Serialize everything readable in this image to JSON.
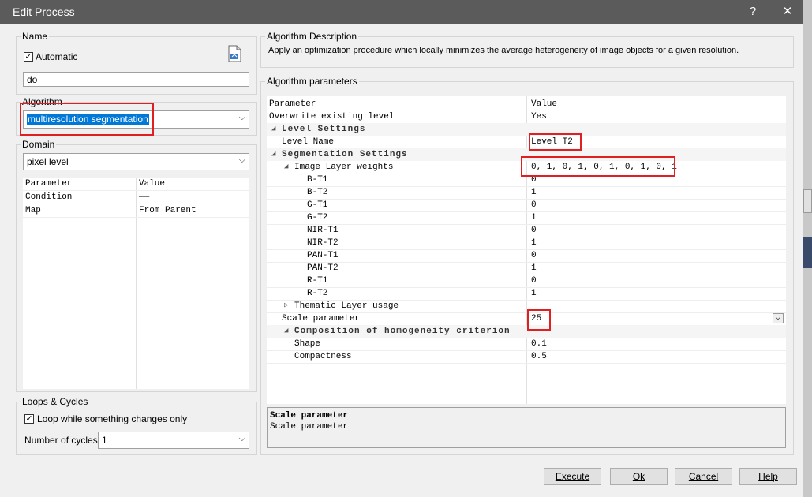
{
  "window": {
    "title": "Edit Process",
    "help_btn": "?",
    "close_btn": "✕"
  },
  "name_group": {
    "label": "Name",
    "automatic_label": "Automatic",
    "automatic_checked": "✓",
    "value": "do"
  },
  "algorithm_group": {
    "label": "Algorithm",
    "selected": "multiresolution segmentation"
  },
  "domain_group": {
    "label": "Domain",
    "selected": "pixel level",
    "table": {
      "headers": [
        "Parameter",
        "Value"
      ],
      "rows": [
        {
          "param": "Condition",
          "value": "——"
        },
        {
          "param": "Map",
          "value": "From Parent"
        }
      ]
    }
  },
  "loops_group": {
    "label": "Loops & Cycles",
    "loop_label": "Loop while something changes only",
    "loop_checked": "✓",
    "cycles_label": "Number of cycles",
    "cycles_value": "1"
  },
  "description_group": {
    "label": "Algorithm Description",
    "text": "Apply an optimization procedure which locally minimizes the average heterogeneity of image objects for a given resolution."
  },
  "params_group": {
    "label": "Algorithm parameters",
    "headers": [
      "Parameter",
      "Value"
    ],
    "rows": [
      {
        "param": "Overwrite existing level",
        "value": "Yes"
      },
      {
        "param": "Level Settings",
        "value": ""
      },
      {
        "param": "Level Name",
        "value": "Level T2"
      },
      {
        "param": "Segmentation Settings",
        "value": ""
      },
      {
        "param": "Image Layer weights",
        "value": "0, 1, 0, 1, 0, 1, 0, 1, 0, 1"
      },
      {
        "param": "B-T1",
        "value": "0"
      },
      {
        "param": "B-T2",
        "value": "1"
      },
      {
        "param": "G-T1",
        "value": "0"
      },
      {
        "param": "G-T2",
        "value": "1"
      },
      {
        "param": "NIR-T1",
        "value": "0"
      },
      {
        "param": "NIR-T2",
        "value": "1"
      },
      {
        "param": "PAN-T1",
        "value": "0"
      },
      {
        "param": "PAN-T2",
        "value": "1"
      },
      {
        "param": "R-T1",
        "value": "0"
      },
      {
        "param": "R-T2",
        "value": "1"
      },
      {
        "param": "Thematic Layer usage",
        "value": ""
      },
      {
        "param": "Scale parameter",
        "value": "25"
      },
      {
        "param": "Composition of homogeneity criterion",
        "value": ""
      },
      {
        "param": "Shape",
        "value": "0.1"
      },
      {
        "param": "Compactness",
        "value": "0.5"
      }
    ],
    "help_title": "Scale parameter",
    "help_text": "Scale parameter"
  },
  "buttons": {
    "execute": "Execute",
    "ok": "Ok",
    "cancel": "Cancel",
    "help": "Help"
  },
  "colors": {
    "highlight": "#e02020",
    "selection": "#0078d7",
    "titlebar": "#5b5b5b"
  }
}
